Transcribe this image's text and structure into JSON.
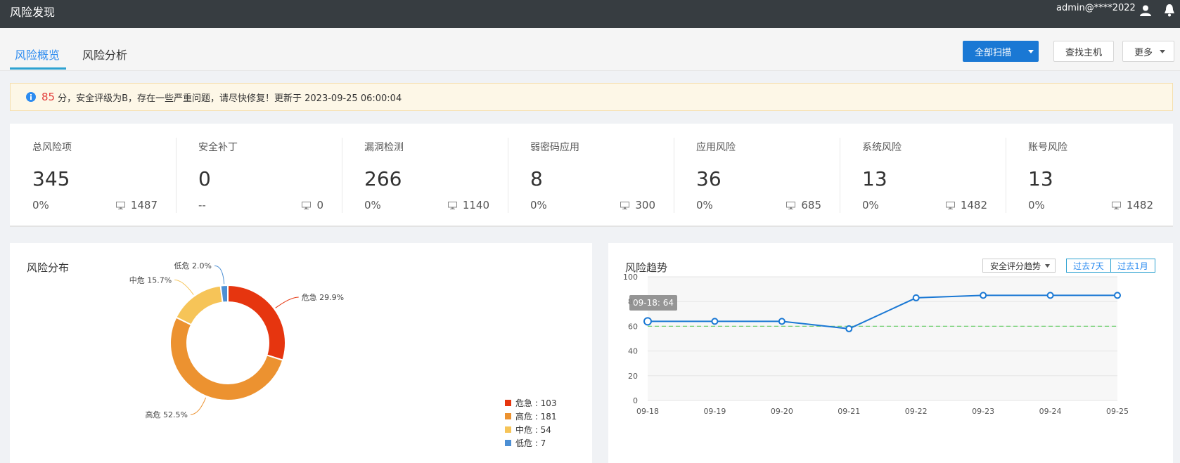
{
  "topbar": {
    "title": "风险发现",
    "user": "admin@****2022",
    "user_icon": "user-icon",
    "bell_icon": "bell-icon"
  },
  "tabs": [
    {
      "label": "风险概览",
      "active": true
    },
    {
      "label": "风险分析",
      "active": false
    }
  ],
  "toolbar": {
    "scan_all": "全部扫描",
    "find_host": "查找主机",
    "more": "更多"
  },
  "alert": {
    "score": "85",
    "message": "分，安全评级为B，存在一些严重问题，请尽快修复！更新于 2023-09-25 06:00:04"
  },
  "stats": [
    {
      "label": "总风险项",
      "value": "345",
      "pct": "0%",
      "hosts": "1487"
    },
    {
      "label": "安全补丁",
      "value": "0",
      "pct": "--",
      "hosts": "0"
    },
    {
      "label": "漏洞检测",
      "value": "266",
      "pct": "0%",
      "hosts": "1140"
    },
    {
      "label": "弱密码应用",
      "value": "8",
      "pct": "0%",
      "hosts": "300"
    },
    {
      "label": "应用风险",
      "value": "36",
      "pct": "0%",
      "hosts": "685"
    },
    {
      "label": "系统风险",
      "value": "13",
      "pct": "0%",
      "hosts": "1482"
    },
    {
      "label": "账号风险",
      "value": "13",
      "pct": "0%",
      "hosts": "1482"
    }
  ],
  "risk_distribution": {
    "title": "风险分布",
    "slice_labels": [
      "危急 29.9%",
      "高危 52.5%",
      "中危 15.7%",
      "低危 2.0%"
    ],
    "legend": [
      "危急 : 103",
      "高危 : 181",
      "中危 : 54",
      "低危 : 7"
    ]
  },
  "risk_trend": {
    "title": "风险趋势",
    "dropdown": "安全评分趋势",
    "range_7d": "过去7天",
    "range_1m": "过去1月",
    "tooltip": "09-18: 64"
  },
  "colors": {
    "critical": "#e6350f",
    "high": "#ec9230",
    "medium": "#f6c458",
    "low": "#4c8fd4",
    "line": "#1a78d4",
    "threshold": "#6fcf6f"
  },
  "chart_data": [
    {
      "type": "pie",
      "title": "风险分布",
      "categories": [
        "危急",
        "高危",
        "中危",
        "低危"
      ],
      "values": [
        103,
        181,
        54,
        7
      ],
      "percentages": [
        29.9,
        52.5,
        15.7,
        2.0
      ],
      "donut": true
    },
    {
      "type": "line",
      "title": "风险趋势",
      "x": [
        "09-18",
        "09-19",
        "09-20",
        "09-21",
        "09-22",
        "09-23",
        "09-24",
        "09-25"
      ],
      "series": [
        {
          "values": [
            64,
            64,
            64,
            58,
            83,
            85,
            85,
            85
          ]
        }
      ],
      "threshold": 60,
      "ylim": [
        0,
        100
      ],
      "yticks": [
        0,
        20,
        40,
        60,
        80,
        100
      ],
      "grid": true
    }
  ]
}
